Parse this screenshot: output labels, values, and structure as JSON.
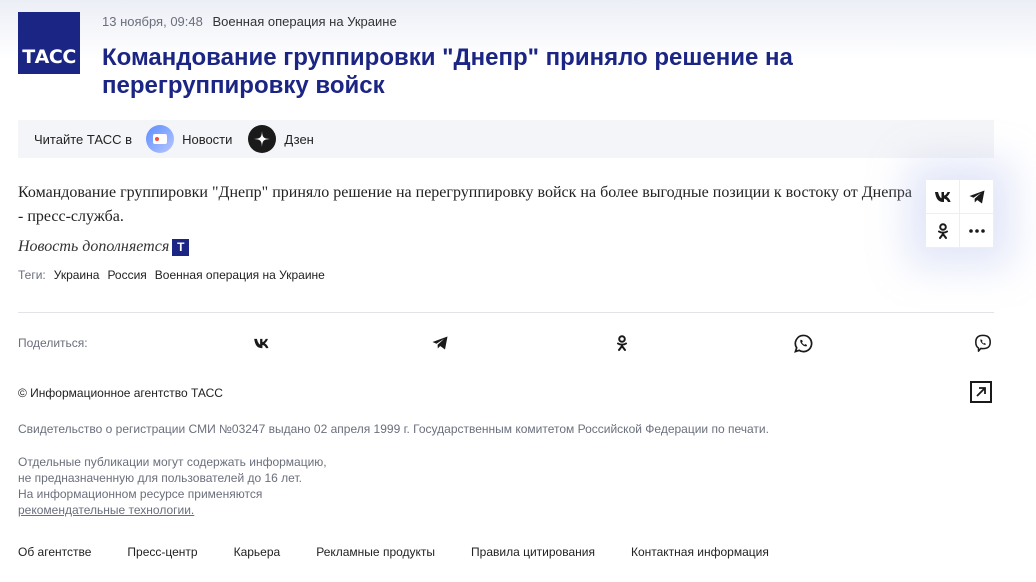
{
  "brand": {
    "logo_text": "ТАСС"
  },
  "article": {
    "date": "13 ноября, 09:48",
    "rubric": "Военная операция на Украине",
    "title": "Командование группировки \"Днепр\" приняло решение на перегруппировку войск",
    "lead": "Командование группировки \"Днепр\" приняло решение на перегруппировку войск на более выгодные позиции к востоку от Днепра - пресс-служба.",
    "update_note": "Новость дополняется",
    "update_badge": "Т"
  },
  "read_bar": {
    "label": "Читайте ТАСС в",
    "items": [
      {
        "label": "Новости",
        "icon": "yandex-news-icon"
      },
      {
        "label": "Дзен",
        "icon": "dzen-icon"
      }
    ]
  },
  "tags": {
    "label": "Теги:",
    "items": [
      "Украина",
      "Россия",
      "Военная операция на Украине"
    ]
  },
  "share_panel": {
    "icons": [
      "vk-icon",
      "telegram-icon",
      "odnoklassniki-icon",
      "more-icon"
    ]
  },
  "share_row": {
    "label": "Поделиться:",
    "icons": [
      "vk-icon",
      "telegram-icon",
      "odnoklassniki-icon",
      "whatsapp-icon",
      "viber-icon"
    ]
  },
  "footer": {
    "copyright": "© Информационное агентство ТАСС",
    "registration": "Свидетельство о регистрации СМИ №03247 выдано 02 апреля 1999 г. Государственным комитетом Российской Федерации по печати.",
    "notice_lines": [
      "Отдельные публикации могут содержать информацию,",
      "не предназначенную для пользователей до 16 лет.",
      "На информационном ресурсе применяются"
    ],
    "notice_link": "рекомендательные технологии.",
    "nav": [
      "Об агентстве",
      "Пресс-центр",
      "Карьера",
      "Рекламные продукты",
      "Правила цитирования",
      "Контактная информация"
    ]
  },
  "colors": {
    "brand": "#1b2583",
    "muted": "#6b6f7c"
  }
}
